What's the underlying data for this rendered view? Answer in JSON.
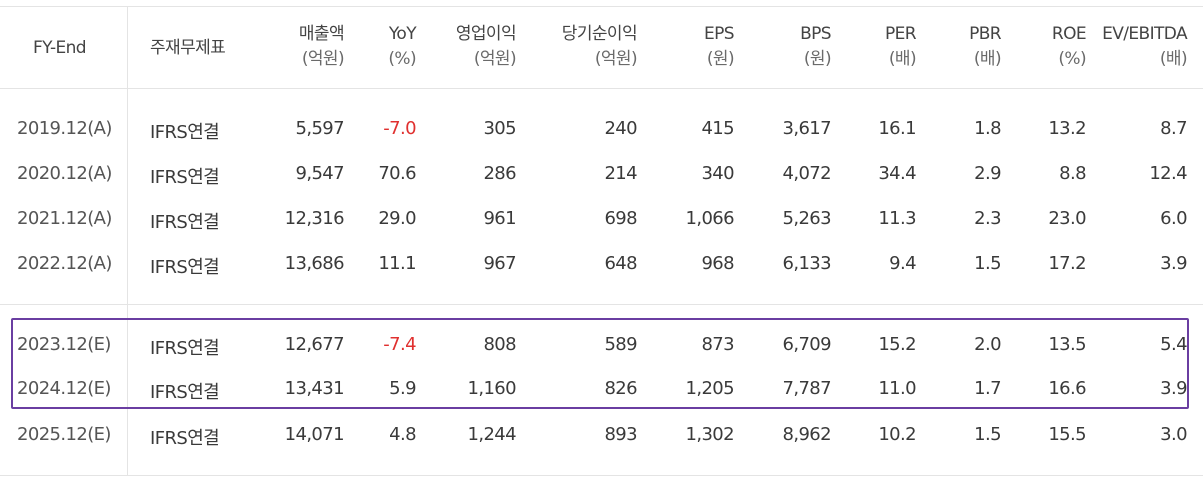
{
  "header": {
    "fy_end": "FY-End",
    "statement_type": "주재무제표",
    "columns": [
      {
        "label": "매출액",
        "unit": "(억원)"
      },
      {
        "label": "YoY",
        "unit": "(%)"
      },
      {
        "label": "영업이익",
        "unit": "(억원)"
      },
      {
        "label": "당기순이익",
        "unit": "(억원)"
      },
      {
        "label": "EPS",
        "unit": "(원)"
      },
      {
        "label": "BPS",
        "unit": "(원)"
      },
      {
        "label": "PER",
        "unit": "(배)"
      },
      {
        "label": "PBR",
        "unit": "(배)"
      },
      {
        "label": "ROE",
        "unit": "(%)"
      },
      {
        "label": "EV/EBITDA",
        "unit": "(배)"
      }
    ]
  },
  "rows": [
    {
      "period": "2019.12(A)",
      "type": "IFRS연결",
      "values": [
        "5,597",
        "-7.0",
        "305",
        "240",
        "415",
        "3,617",
        "16.1",
        "1.8",
        "13.2",
        "8.7"
      ]
    },
    {
      "period": "2020.12(A)",
      "type": "IFRS연결",
      "values": [
        "9,547",
        "70.6",
        "286",
        "214",
        "340",
        "4,072",
        "34.4",
        "2.9",
        "8.8",
        "12.4"
      ]
    },
    {
      "period": "2021.12(A)",
      "type": "IFRS연결",
      "values": [
        "12,316",
        "29.0",
        "961",
        "698",
        "1,066",
        "5,263",
        "11.3",
        "2.3",
        "23.0",
        "6.0"
      ]
    },
    {
      "period": "2022.12(A)",
      "type": "IFRS연결",
      "values": [
        "13,686",
        "11.1",
        "967",
        "648",
        "968",
        "6,133",
        "9.4",
        "1.5",
        "17.2",
        "3.9"
      ]
    },
    {
      "period": "2023.12(E)",
      "type": "IFRS연결",
      "values": [
        "12,677",
        "-7.4",
        "808",
        "589",
        "873",
        "6,709",
        "15.2",
        "2.0",
        "13.5",
        "5.4"
      ]
    },
    {
      "period": "2024.12(E)",
      "type": "IFRS연결",
      "values": [
        "13,431",
        "5.9",
        "1,160",
        "826",
        "1,205",
        "7,787",
        "11.0",
        "1.7",
        "16.6",
        "3.9"
      ]
    },
    {
      "period": "2025.12(E)",
      "type": "IFRS연결",
      "values": [
        "14,071",
        "4.8",
        "1,244",
        "893",
        "1,302",
        "8,962",
        "10.2",
        "1.5",
        "15.5",
        "3.0"
      ]
    }
  ],
  "colors": {
    "highlight_border": "#6a3ea1",
    "negative": "#e0302f",
    "grid": "#e4e4e4"
  }
}
